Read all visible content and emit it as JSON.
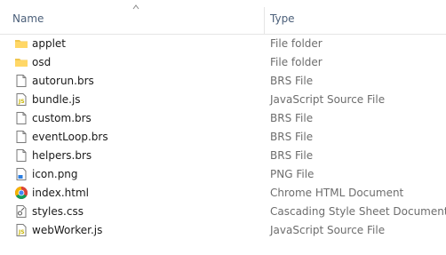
{
  "header": {
    "name_label": "Name",
    "type_label": "Type"
  },
  "files": [
    {
      "name": "applet",
      "type": "File folder",
      "icon": "folder-icon"
    },
    {
      "name": "osd",
      "type": "File folder",
      "icon": "folder-icon"
    },
    {
      "name": "autorun.brs",
      "type": "BRS File",
      "icon": "file-icon"
    },
    {
      "name": "bundle.js",
      "type": "JavaScript Source File",
      "icon": "js-file-icon"
    },
    {
      "name": "custom.brs",
      "type": "BRS File",
      "icon": "file-icon"
    },
    {
      "name": "eventLoop.brs",
      "type": "BRS File",
      "icon": "file-icon"
    },
    {
      "name": "helpers.brs",
      "type": "BRS File",
      "icon": "file-icon"
    },
    {
      "name": "icon.png",
      "type": "PNG File",
      "icon": "image-file-icon"
    },
    {
      "name": "index.html",
      "type": "Chrome HTML Document",
      "icon": "chrome-icon"
    },
    {
      "name": "styles.css",
      "type": "Cascading Style Sheet Document",
      "icon": "css-file-icon"
    },
    {
      "name": "webWorker.js",
      "type": "JavaScript Source File",
      "icon": "js-file-icon"
    }
  ],
  "colors": {
    "header_text": "#4c607a",
    "folder": "#f0c64e",
    "js_accent": "#c8b400",
    "chrome_red": "#db4437",
    "chrome_yellow": "#f4b400",
    "chrome_green": "#0f9d58",
    "chrome_blue": "#4285f4"
  }
}
